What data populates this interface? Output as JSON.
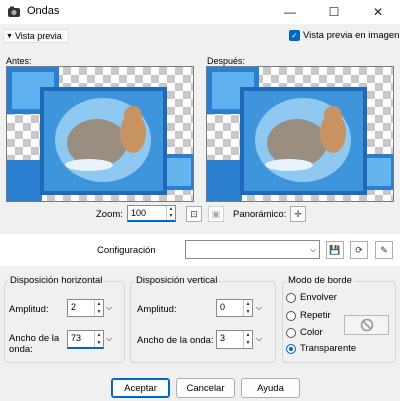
{
  "window": {
    "title": "Ondas",
    "controls": [
      "—",
      "☐",
      "✕"
    ]
  },
  "header": {
    "preview_toggle": "Vista previa",
    "preview_in_image": "Vista previa en imagen"
  },
  "panes": {
    "before_label": "Antes:",
    "after_label": "Después:"
  },
  "zoom": {
    "label": "Zoom:",
    "value": "100"
  },
  "pan": {
    "label": "Panorámico:"
  },
  "config": {
    "label": "Configuración",
    "value": ""
  },
  "horizontal": {
    "title": "Disposición horizontal",
    "amplitude_label": "Amplitud:",
    "amplitude_value": "2",
    "wavelength_label": "Ancho de la onda:",
    "wavelength_value": "73"
  },
  "vertical": {
    "title": "Disposición vertical",
    "amplitude_label": "Amplitud:",
    "amplitude_value": "0",
    "wavelength_label": "Ancho de la onda:",
    "wavelength_value": "3"
  },
  "edge": {
    "title": "Modo de borde",
    "options": [
      "Envolver",
      "Repetir",
      "Color",
      "Transparente"
    ],
    "selected": "Transparente"
  },
  "buttons": {
    "ok": "Aceptar",
    "cancel": "Cancelar",
    "help": "Ayuda"
  },
  "colors": {
    "accent": "#0067c0",
    "frame_blue": "#2a7fd0"
  }
}
